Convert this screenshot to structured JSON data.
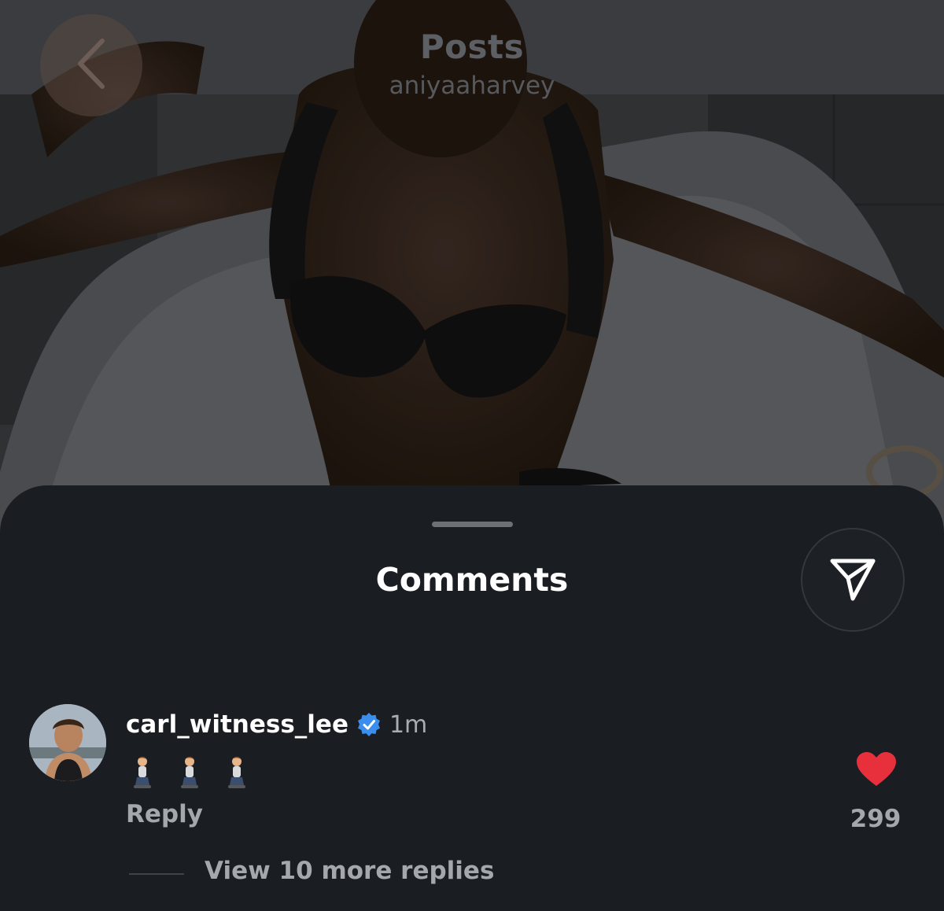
{
  "header": {
    "title": "Posts",
    "username": "aniyaaharvey"
  },
  "sheet": {
    "title": "Comments"
  },
  "comment": {
    "username": "carl_witness_lee",
    "verified": true,
    "time": "1m",
    "emojis": [
      "person-kneeling-emoji",
      "person-kneeling-emoji",
      "person-kneeling-emoji"
    ],
    "reply_label": "Reply",
    "like_count": "299",
    "liked": true,
    "view_more_label": "View 10 more replies"
  },
  "colors": {
    "sheet_bg": "#1a1d22",
    "like_red": "#e8303c",
    "verified_blue": "#3b8eed"
  },
  "icons": {
    "back": "chevron-left-icon",
    "share": "paper-plane-icon",
    "like": "heart-icon",
    "verified": "verified-badge-icon"
  }
}
